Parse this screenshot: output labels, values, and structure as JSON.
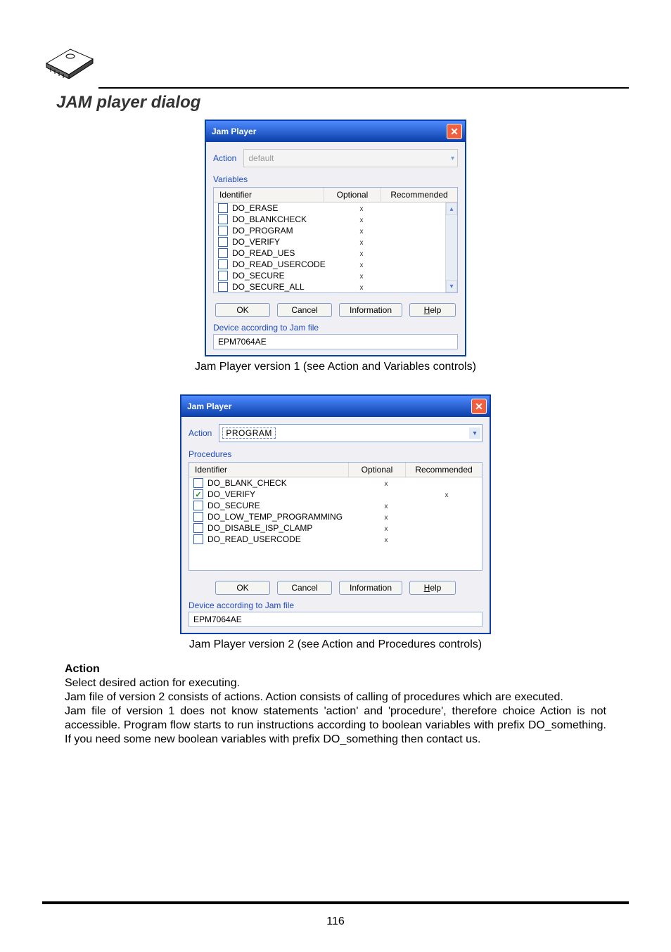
{
  "section_title": "JAM player dialog",
  "dialog1": {
    "title": "Jam Player",
    "action_label": "Action",
    "action_value": "default",
    "list_label": "Variables",
    "headers": {
      "id": "Identifier",
      "opt": "Optional",
      "rec": "Recommended"
    },
    "rows": [
      {
        "id": "DO_ERASE",
        "opt": "x",
        "rec": "",
        "checked": false
      },
      {
        "id": "DO_BLANKCHECK",
        "opt": "x",
        "rec": "",
        "checked": false
      },
      {
        "id": "DO_PROGRAM",
        "opt": "x",
        "rec": "",
        "checked": false
      },
      {
        "id": "DO_VERIFY",
        "opt": "x",
        "rec": "",
        "checked": false
      },
      {
        "id": "DO_READ_UES",
        "opt": "x",
        "rec": "",
        "checked": false
      },
      {
        "id": "DO_READ_USERCODE",
        "opt": "x",
        "rec": "",
        "checked": false
      },
      {
        "id": "DO_SECURE",
        "opt": "x",
        "rec": "",
        "checked": false
      },
      {
        "id": "DO_SECURE_ALL",
        "opt": "x",
        "rec": "",
        "checked": false
      }
    ],
    "buttons": {
      "ok": "OK",
      "cancel": "Cancel",
      "info": "Information",
      "help_prefix": "H",
      "help_rest": "elp"
    },
    "device_label": "Device according to Jam file",
    "device_value": "EPM7064AE"
  },
  "caption1": "Jam Player version 1 (see Action and Variables controls)",
  "dialog2": {
    "title": "Jam Player",
    "action_label": "Action",
    "action_value": "PROGRAM",
    "list_label": "Procedures",
    "headers": {
      "id": "Identifier",
      "opt": "Optional",
      "rec": "Recommended"
    },
    "rows": [
      {
        "id": "DO_BLANK_CHECK",
        "opt": "x",
        "rec": "",
        "checked": false
      },
      {
        "id": "DO_VERIFY",
        "opt": "",
        "rec": "x",
        "checked": true
      },
      {
        "id": "DO_SECURE",
        "opt": "x",
        "rec": "",
        "checked": false
      },
      {
        "id": "DO_LOW_TEMP_PROGRAMMING",
        "opt": "x",
        "rec": "",
        "checked": false
      },
      {
        "id": "DO_DISABLE_ISP_CLAMP",
        "opt": "x",
        "rec": "",
        "checked": false
      },
      {
        "id": "DO_READ_USERCODE",
        "opt": "x",
        "rec": "",
        "checked": false
      }
    ],
    "buttons": {
      "ok": "OK",
      "cancel": "Cancel",
      "info": "Information",
      "help_prefix": "H",
      "help_rest": "elp"
    },
    "device_label": "Device according to Jam file",
    "device_value": "EPM7064AE"
  },
  "caption2": "Jam Player version 2 (see Action and Procedures controls)",
  "body": {
    "heading": "Action",
    "p1": "Select desired action for executing.",
    "p2": "Jam file of version 2 consists of actions. Action consists of calling of procedures which are executed.",
    "p3": "Jam file of version 1 does not know statements 'action' and 'procedure', therefore choice Action is not accessible. Program flow starts to run instructions according to boolean variables with prefix DO_something. If you need some new boolean variables with prefix DO_something then contact us."
  },
  "page_number": "116"
}
